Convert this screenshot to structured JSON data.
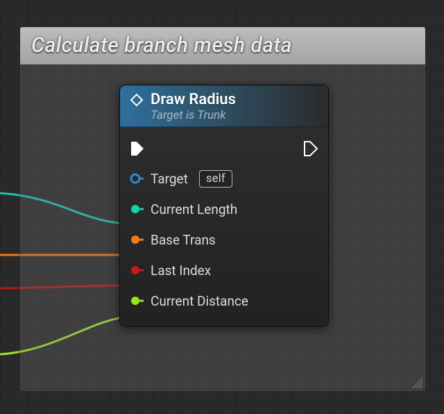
{
  "comment": {
    "title": "Calculate branch mesh data"
  },
  "node": {
    "title": "Draw Radius",
    "subtitle": "Target is Trunk",
    "pins": {
      "target": {
        "label": "Target",
        "self_text": "self",
        "color": "#2e8bd6",
        "connected": false,
        "hollow": true
      },
      "current_length": {
        "label": "Current Length",
        "color": "#16d3b0",
        "connected": true
      },
      "base_trans": {
        "label": "Base Trans",
        "color": "#f07a18",
        "connected": true
      },
      "last_index": {
        "label": "Last Index",
        "color": "#c01d1d",
        "connected": true
      },
      "current_distance": {
        "label": "Current Distance",
        "color": "#8fe817",
        "connected": true
      }
    }
  },
  "wires": {
    "teal": "#16c7ab",
    "orange": "#ef7918",
    "red": "#b41717",
    "lime": "#9de32a"
  }
}
